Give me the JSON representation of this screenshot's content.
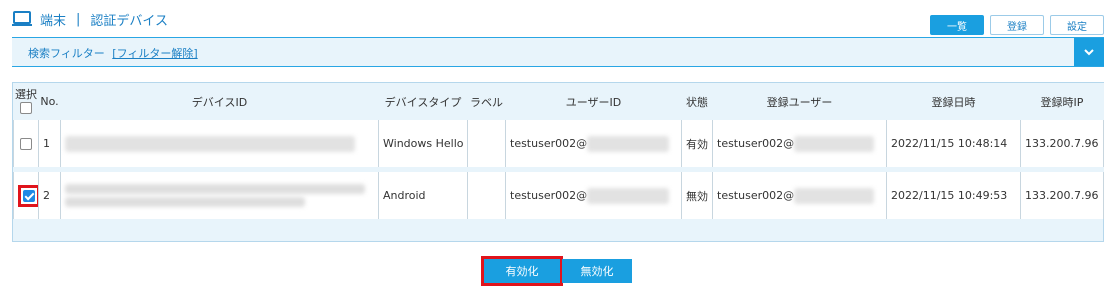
{
  "header": {
    "section": "端末",
    "separator": "|",
    "title": "認証デバイス"
  },
  "top_buttons": {
    "list": "一覧",
    "register": "登録",
    "settings": "設定"
  },
  "filter": {
    "label": "検索フィルター",
    "clear_link": "[フィルター解除]"
  },
  "table": {
    "columns": {
      "select": "選択",
      "no": "No.",
      "device_id": "デバイスID",
      "device_type": "デバイスタイプ",
      "label": "ラベル",
      "user_id": "ユーザーID",
      "status": "状態",
      "registered_user": "登録ユーザー",
      "registered_date": "登録日時",
      "registered_ip": "登録時IP"
    },
    "rows": [
      {
        "checked": false,
        "no": "1",
        "device_type": "Windows Hello",
        "label": "",
        "user_id": "testuser002@",
        "status": "有効",
        "registered_user": "testuser002@",
        "registered_date": "2022/11/15 10:48:14",
        "registered_ip": "133.200.7.96"
      },
      {
        "checked": true,
        "no": "2",
        "device_type": "Android",
        "label": "",
        "user_id": "testuser002@",
        "status": "無効",
        "registered_user": "testuser002@",
        "registered_date": "2022/11/15 10:49:53",
        "registered_ip": "133.200.7.96"
      }
    ]
  },
  "actions": {
    "enable": "有効化",
    "disable": "無効化"
  },
  "colors": {
    "accent": "#1a9fe0",
    "highlight": "#e0141c",
    "panel_bg": "#e8f4fb"
  },
  "icons": {
    "header": "monitor-icon",
    "filter_toggle": "chevron-down-icon",
    "checkbox": "checkmark-icon"
  }
}
